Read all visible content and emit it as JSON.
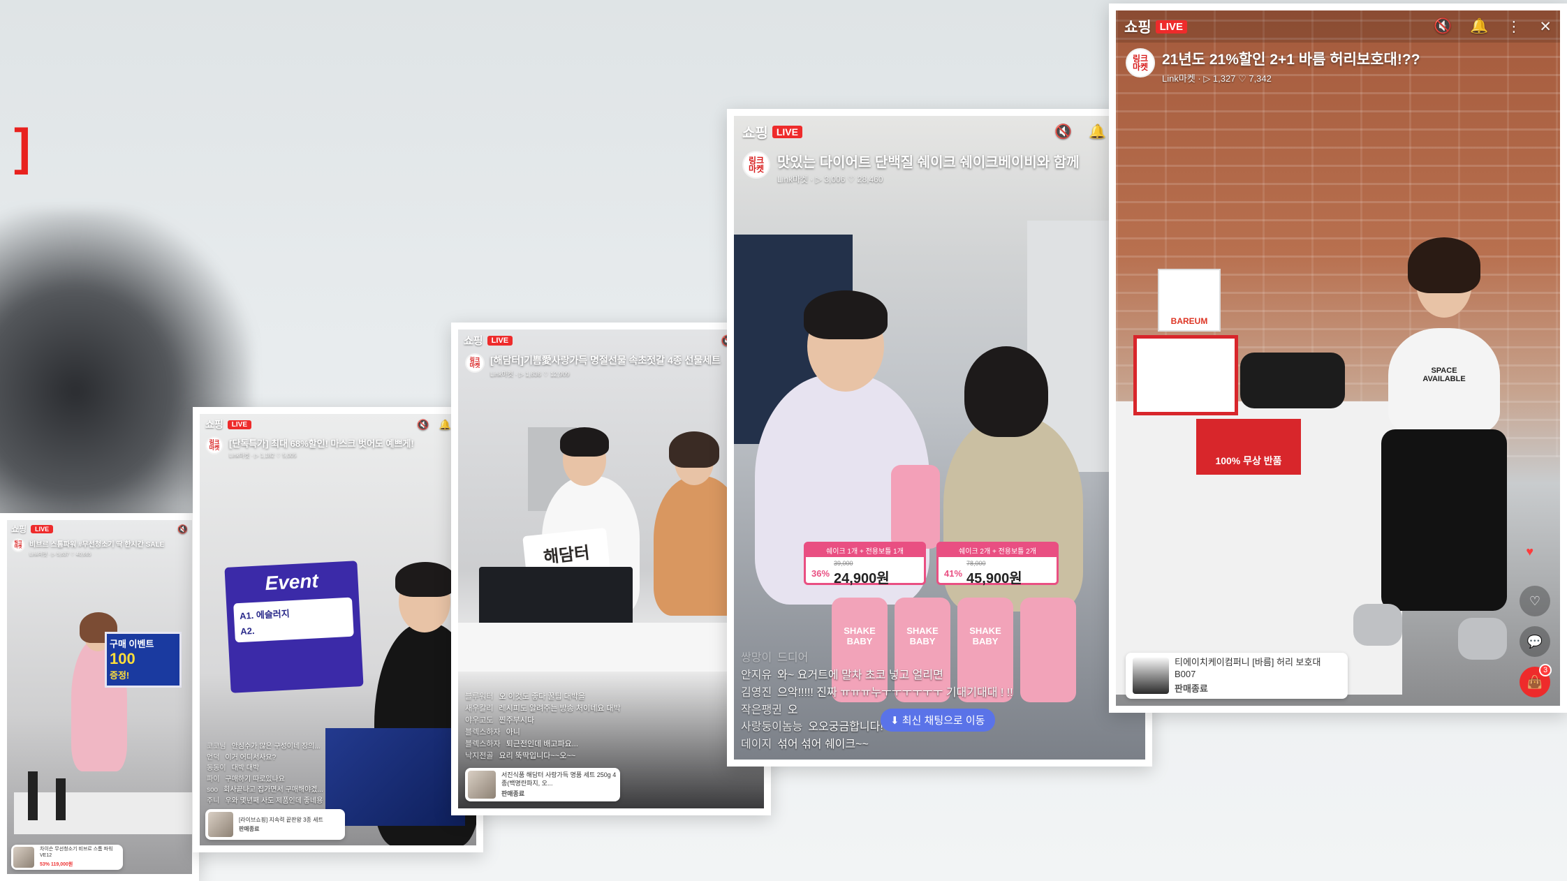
{
  "decor": {
    "bracket": "]"
  },
  "common": {
    "brand": "쇼핑",
    "live": "LIVE",
    "avatar": "링크\n마켓"
  },
  "screens": [
    {
      "title": "비브르 스톰파워 #무선청소기 딱 한시간 SALE",
      "meta": "Link마켓 · ▷ 5,637 ♡ 40,665",
      "chat": [],
      "product": {
        "name": "차이슨 무선청소기 비브르 스톰 파워 VE12",
        "status": "53% 119,000원"
      },
      "scene_text": {
        "sign_title": "구매 이벤트",
        "sign_count": "100",
        "sign_note": "증정!"
      }
    },
    {
      "title": "[단독특가] 최대 68%할인! 마스크 벗어도 예쁘게!",
      "meta": "Link마켓 · ▷ 1,182 ♡ 5,005",
      "chat": [
        {
          "u": "코코님",
          "m": "안심수가 많은 구성이네 장의..."
        },
        {
          "u": "언덕",
          "m": "이거 어디서사요?"
        },
        {
          "u": "동동이",
          "m": "대박 대박"
        },
        {
          "u": "파이",
          "m": "구매하기 따로있나요"
        },
        {
          "u": "soo",
          "m": "회사끝나고 집가면서 구매해야겠..."
        },
        {
          "u": "주니",
          "m": "우와 몇년째 사도 제품인데 좋네용"
        }
      ],
      "product": {
        "name": "[라이브쇼핑] 지속력 끝판왕 3종 세트",
        "status": "판매종료"
      },
      "scene_text": {
        "event": "Event",
        "q": "A1. 에슬러지",
        "a": "A2."
      }
    },
    {
      "title": "[해담터]기쁨愛사랑가득 명절선물 속초젓갈 4종 선물세트",
      "meta": "Link마켓 · ▷ 1,636 ♡ 12,909",
      "chat": [
        {
          "u": "블루워터",
          "m": "오 이것도 좋다 꿀팁 대박을"
        },
        {
          "u": "새우칼리",
          "m": "레시피도 알려주는 방송 처이네요 대박"
        },
        {
          "u": "야우고도",
          "m": "찐주부시다"
        },
        {
          "u": "블렉스하자",
          "m": "아니"
        },
        {
          "u": "블렉스하자",
          "m": "퇴근전인데 배고파요..."
        },
        {
          "u": "낙지전골",
          "m": "요리 뚝딱입니다~~오~~"
        }
      ],
      "product": {
        "name": "서진식품 해담터 사랑가득 명품 세트 250g 4종(백명란파지, 오...",
        "status": "판매종료"
      },
      "scene_text": {
        "sign": "해담터"
      }
    },
    {
      "title": "맛있는 다이어트 단백질 쉐이크 쉐이크베이비와 함께",
      "meta": "Link마켓 · ▷ 3,006 ♡ 28,460",
      "chat": [
        {
          "u": "쌍망이",
          "m": "드디어"
        },
        {
          "u": "안지유",
          "m": "와~ 요거트에 말차 초코 넣고 얼리면"
        },
        {
          "u": "김영진",
          "m": "으악!!!!! 진짜 ㅠㅠㅠ누ㅜㅜㅜㅜㅜㅜ 기대기대대 ! !!"
        },
        {
          "u": "작은팽귄",
          "m": "오"
        },
        {
          "u": "사랑둥이놈능",
          "m": "오오궁금합니다!"
        },
        {
          "u": "데이지",
          "m": "섞어 섞어 쉐이크~~"
        }
      ],
      "chat_jump": "최신 채팅으로 이동",
      "prices": [
        {
          "label": "쉐이크 1개 + 전용보틀 1개",
          "pct": "36%",
          "old": "39,000",
          "price": "24,900원"
        },
        {
          "label": "쉐이크 2개 + 전용보틀 2개",
          "pct": "41%",
          "old": "78,000",
          "price": "45,900원"
        }
      ],
      "scene_text": {
        "jar": "SHAKE BABY"
      }
    },
    {
      "title": "21년도 21%할인 2+1 바름 허리보호대!??",
      "meta": "Link마켓 · ▷ 1,327 ♡ 7,342",
      "chat": [],
      "product": {
        "name": "티에이치케이컴퍼니 [바름] 허리 보호대 B007",
        "status": "판매종료"
      },
      "cart_count": "3",
      "scene_text": {
        "logo": "BAREUM",
        "poster": "100% 무상 반품",
        "shirt": "SPACE AVAILABLE"
      }
    }
  ]
}
